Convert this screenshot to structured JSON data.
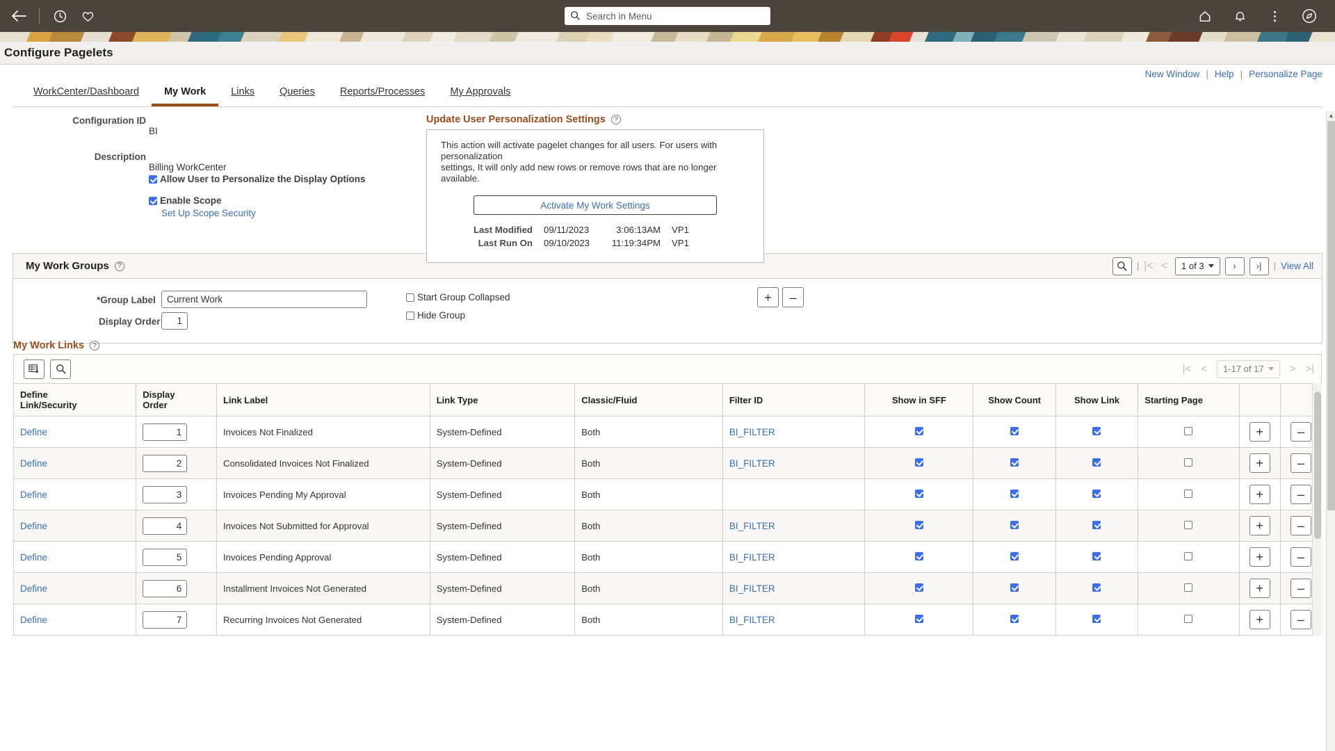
{
  "topbar": {
    "back_icon": "back-arrow-icon",
    "history_icon": "clock-icon",
    "favorites_icon": "heart-icon",
    "home_icon": "home-icon",
    "notifications_icon": "bell-icon",
    "actions_icon": "kebab-menu-icon",
    "navigator_icon": "compass-icon",
    "search_placeholder": "Search in Menu",
    "search_value": ""
  },
  "page": {
    "title": "Configure Pagelets"
  },
  "utility_links": [
    {
      "label": "New Window"
    },
    {
      "label": "Help"
    },
    {
      "label": "Personalize Page"
    }
  ],
  "tabs": [
    {
      "label": "WorkCenter/Dashboard",
      "active": false
    },
    {
      "label": "My Work",
      "active": true
    },
    {
      "label": "Links",
      "active": false
    },
    {
      "label": "Queries",
      "active": false
    },
    {
      "label": "Reports/Processes",
      "active": false
    },
    {
      "label": "My Approvals",
      "active": false
    }
  ],
  "config": {
    "configuration_id_label": "Configuration ID",
    "configuration_id_value": "BI",
    "description_label": "Description",
    "description_value": "Billing WorkCenter",
    "allow_personalize_label": "Allow User to Personalize the Display Options",
    "allow_personalize_checked": true,
    "enable_scope_label": "Enable Scope",
    "enable_scope_checked": true,
    "scope_security_link": "Set Up Scope Security"
  },
  "personalization": {
    "heading": "Update User Personalization Settings",
    "help_icon": "help-icon",
    "body_line1": "This action will activate pagelet changes for all users.  For users with personalization",
    "body_line2": "settings, It will only add new rows or remove rows that are no longer available.",
    "activate_button": "Activate My Work Settings",
    "last_modified_label": "Last Modified",
    "last_modified_date": "09/11/2023",
    "last_modified_time": "3:06:13AM",
    "last_modified_user": "VP1",
    "last_run_label": "Last Run On",
    "last_run_date": "09/10/2023",
    "last_run_time": "11:19:34PM",
    "last_run_user": "VP1"
  },
  "work_groups": {
    "heading": "My Work Groups",
    "help_icon": "help-icon",
    "search_icon": "search-icon",
    "first_icon": "first-page-icon",
    "prev_icon": "previous-page-icon",
    "page_indicator": "1 of 3",
    "next_icon": "next-page-icon",
    "last_icon": "last-page-icon",
    "view_all": "View All",
    "group_label_label": "*Group Label",
    "group_label_value": "Current Work",
    "display_order_label": "Display Order",
    "display_order_value": "1",
    "start_collapsed_label": "Start Group Collapsed",
    "start_collapsed_checked": false,
    "hide_group_label": "Hide Group",
    "hide_group_checked": false,
    "add_row_button": "+",
    "delete_row_button": "–"
  },
  "work_links": {
    "heading": "My Work Links",
    "help_icon": "help-icon",
    "personalize_icon": "grid-personalize-icon",
    "find_icon": "search-icon",
    "first_icon": "first-page-icon",
    "prev_icon": "previous-page-icon",
    "range_indicator": "1-17 of 17",
    "next_icon": "next-page-icon",
    "last_icon": "last-page-icon",
    "columns": [
      "Define Link/Security",
      "Display Order",
      "Link Label",
      "Link Type",
      "Classic/Fluid",
      "Filter ID",
      "Show in SFF",
      "Show Count",
      "Show Link",
      "Starting Page"
    ],
    "rows": [
      {
        "define": "Define",
        "order": "1",
        "label": "Invoices Not Finalized",
        "type": "System-Defined",
        "classic_fluid": "Both",
        "filter_id": "BI_FILTER",
        "show_sff": true,
        "show_count": true,
        "show_link": true,
        "starting_page": false
      },
      {
        "define": "Define",
        "order": "2",
        "label": "Consolidated Invoices Not Finalized",
        "type": "System-Defined",
        "classic_fluid": "Both",
        "filter_id": "BI_FILTER",
        "show_sff": true,
        "show_count": true,
        "show_link": true,
        "starting_page": false
      },
      {
        "define": "Define",
        "order": "3",
        "label": "Invoices Pending My Approval",
        "type": "System-Defined",
        "classic_fluid": "Both",
        "filter_id": "",
        "show_sff": true,
        "show_count": true,
        "show_link": true,
        "starting_page": false
      },
      {
        "define": "Define",
        "order": "4",
        "label": "Invoices Not Submitted for Approval",
        "type": "System-Defined",
        "classic_fluid": "Both",
        "filter_id": "BI_FILTER",
        "show_sff": true,
        "show_count": true,
        "show_link": true,
        "starting_page": false
      },
      {
        "define": "Define",
        "order": "5",
        "label": "Invoices Pending Approval",
        "type": "System-Defined",
        "classic_fluid": "Both",
        "filter_id": "BI_FILTER",
        "show_sff": true,
        "show_count": true,
        "show_link": true,
        "starting_page": false
      },
      {
        "define": "Define",
        "order": "6",
        "label": "Installment Invoices Not Generated",
        "type": "System-Defined",
        "classic_fluid": "Both",
        "filter_id": "BI_FILTER",
        "show_sff": true,
        "show_count": true,
        "show_link": true,
        "starting_page": false
      },
      {
        "define": "Define",
        "order": "7",
        "label": "Recurring Invoices Not Generated",
        "type": "System-Defined",
        "classic_fluid": "Both",
        "filter_id": "BI_FILTER",
        "show_sff": true,
        "show_count": true,
        "show_link": true,
        "starting_page": false
      }
    ],
    "add_row_button": "+",
    "delete_row_button": "–"
  },
  "colors": {
    "topbar_bg": "#4a443c",
    "accent_brown": "#9c4d1c",
    "link_blue": "#3a6fb5",
    "checkbox_blue": "#3b6ee8",
    "panel_header_bg": "#f7f6f5"
  }
}
